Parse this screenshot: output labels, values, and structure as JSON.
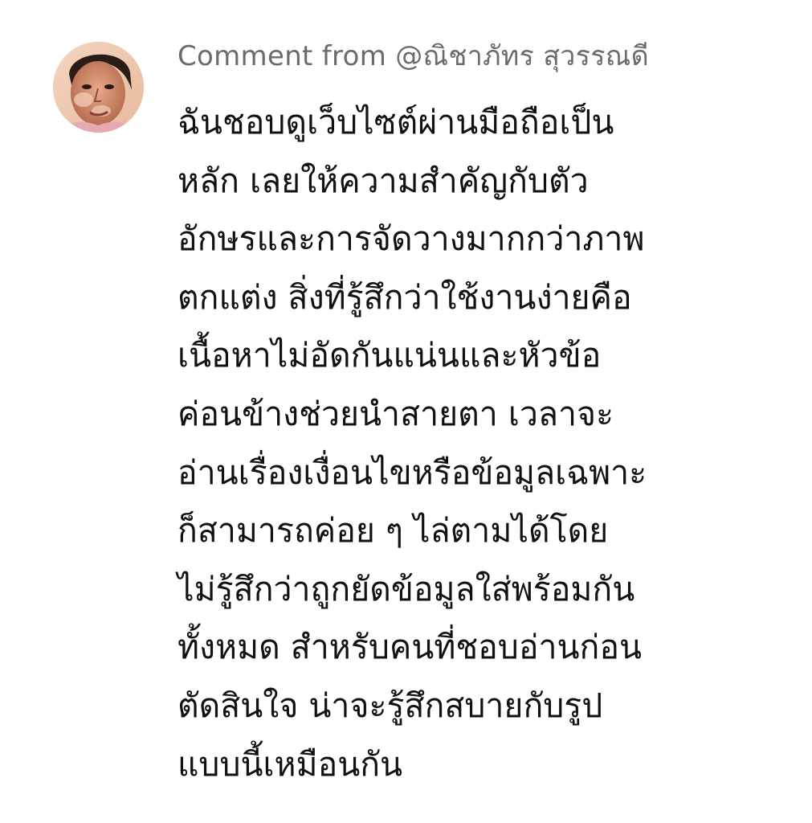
{
  "comment": {
    "avatar_icon": "user-avatar-photo",
    "header": "Comment from @ณิชาภัทร สุวรรณดี",
    "lines": [
      "ฉันชอบดูเว็บไซต์ผ่านมือถือเป็น",
      "หลัก เลยให้ความสำคัญกับตัว",
      "อักษรและการจัดวางมากกว่าภาพ",
      "ตกแต่ง สิ่งที่รู้สึกว่าใช้งานง่ายคือ",
      "เนื้อหาไม่อัดกันแน่นและหัวข้อ",
      "ค่อนข้างช่วยนำสายตา เวลาจะ",
      "อ่านเรื่องเงื่อนไขหรือข้อมูลเฉพาะ",
      "ก็สามารถค่อย ๆ ไล่ตามได้โดย",
      "ไม่รู้สึกว่าถูกยัดข้อมูลใส่พร้อมกัน",
      "ทั้งหมด สำหรับคนที่ชอบอ่านก่อน",
      "ตัดสินใจ น่าจะรู้สึกสบายกับรูป",
      "แบบนี้เหมือนกัน"
    ]
  }
}
